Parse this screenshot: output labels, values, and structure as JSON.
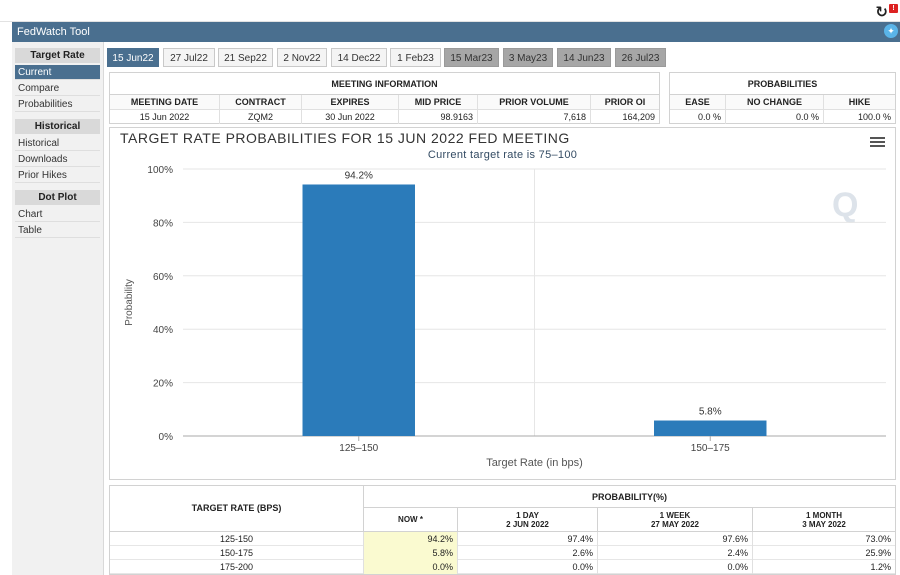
{
  "app": {
    "title": "FedWatch Tool",
    "refresh_icon": "refresh-icon",
    "twitter_icon": "twitter-icon"
  },
  "sidebar": {
    "sections": [
      {
        "heading": "Target Rate",
        "items": [
          "Current",
          "Compare",
          "Probabilities"
        ],
        "active": 0
      },
      {
        "heading": "Historical",
        "items": [
          "Historical",
          "Downloads",
          "Prior Hikes"
        ],
        "active": -1
      },
      {
        "heading": "Dot Plot",
        "items": [
          "Chart",
          "Table"
        ],
        "active": -1
      }
    ]
  },
  "tabs": [
    {
      "label": "15 Jun22",
      "state": "active"
    },
    {
      "label": "27 Jul22",
      "state": "normal"
    },
    {
      "label": "21 Sep22",
      "state": "normal"
    },
    {
      "label": "2 Nov22",
      "state": "normal"
    },
    {
      "label": "14 Dec22",
      "state": "normal"
    },
    {
      "label": "1 Feb23",
      "state": "normal"
    },
    {
      "label": "15 Mar23",
      "state": "gray"
    },
    {
      "label": "3 May23",
      "state": "gray"
    },
    {
      "label": "14 Jun23",
      "state": "gray"
    },
    {
      "label": "26 Jul23",
      "state": "gray"
    }
  ],
  "meeting_info": {
    "heading": "MEETING INFORMATION",
    "columns": [
      "MEETING DATE",
      "CONTRACT",
      "EXPIRES",
      "MID PRICE",
      "PRIOR VOLUME",
      "PRIOR OI"
    ],
    "values": [
      "15 Jun 2022",
      "ZQM2",
      "30 Jun 2022",
      "98.9163",
      "7,618",
      "164,209"
    ]
  },
  "probabilities": {
    "heading": "PROBABILITIES",
    "columns": [
      "EASE",
      "NO CHANGE",
      "HIKE"
    ],
    "values": [
      "0.0 %",
      "0.0 %",
      "100.0 %"
    ]
  },
  "chart_data": {
    "type": "bar",
    "title": "TARGET RATE PROBABILITIES FOR 15 JUN 2022 FED MEETING",
    "subtitle": "Current target rate is 75–100",
    "xlabel": "Target Rate (in bps)",
    "ylabel": "Probability",
    "categories": [
      "125–150",
      "150–175"
    ],
    "values": [
      94.2,
      5.8
    ],
    "data_labels": [
      "94.2%",
      "5.8%"
    ],
    "ylim": [
      0,
      100
    ],
    "yticks": [
      0,
      20,
      40,
      60,
      80,
      100
    ],
    "ytick_labels": [
      "0%",
      "20%",
      "40%",
      "60%",
      "80%",
      "100%"
    ],
    "grid": true,
    "bar_color": "#2b7bba",
    "menu_icon": "hamburger-menu-icon",
    "watermark_icon": "q-logo-icon"
  },
  "prob_table": {
    "left_heading": "TARGET RATE (BPS)",
    "right_heading": "PROBABILITY(%)",
    "subheads": [
      {
        "line1": "NOW *",
        "line2": ""
      },
      {
        "line1": "1 DAY",
        "line2": "2 JUN 2022"
      },
      {
        "line1": "1 WEEK",
        "line2": "27 MAY 2022"
      },
      {
        "line1": "1 MONTH",
        "line2": "3 MAY 2022"
      }
    ],
    "rows": [
      {
        "rate": "125-150",
        "now": "94.2%",
        "day": "97.4%",
        "week": "97.6%",
        "month": "73.0%"
      },
      {
        "rate": "150-175",
        "now": "5.8%",
        "day": "2.6%",
        "week": "2.4%",
        "month": "25.9%"
      },
      {
        "rate": "175-200",
        "now": "0.0%",
        "day": "0.0%",
        "week": "0.0%",
        "month": "1.2%"
      }
    ]
  }
}
